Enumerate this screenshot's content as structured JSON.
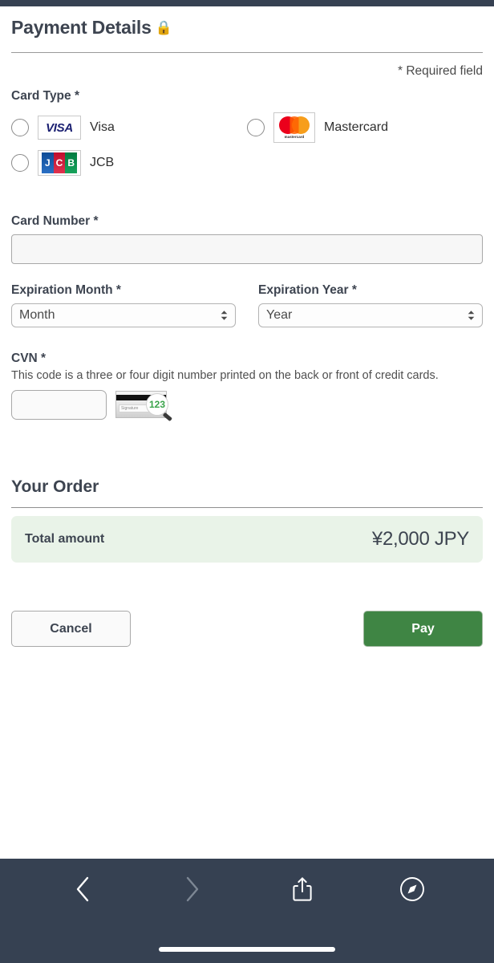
{
  "header": {
    "title": "Payment Details",
    "lock_icon": "lock-emoji",
    "required_note": "* Required field"
  },
  "form": {
    "card_type": {
      "label": "Card Type *",
      "options": [
        {
          "id": "visa",
          "label": "Visa",
          "brand": "VISA",
          "selected": false
        },
        {
          "id": "mastercard",
          "label": "Mastercard",
          "brand": "mastercard",
          "selected": false
        },
        {
          "id": "jcb",
          "label": "JCB",
          "brand": "JCB",
          "selected": false
        }
      ]
    },
    "card_number": {
      "label": "Card Number *",
      "value": "",
      "placeholder": ""
    },
    "expiration_month": {
      "label": "Expiration Month *",
      "selected": "Month"
    },
    "expiration_year": {
      "label": "Expiration Year *",
      "selected": "Year"
    },
    "cvn": {
      "label": "CVN *",
      "hint": "This code is a three or four digit number printed on the back or front of credit cards.",
      "value": "",
      "hint_image_digits": "123",
      "hint_image_signature": "Signature"
    }
  },
  "order": {
    "title": "Your Order",
    "total_label": "Total amount",
    "total_value": "¥2,000 JPY"
  },
  "actions": {
    "cancel_label": "Cancel",
    "pay_label": "Pay"
  },
  "browser_toolbar": {
    "back_icon": "chevron-left-icon",
    "forward_icon": "chevron-right-icon",
    "share_icon": "share-icon",
    "safari_icon": "compass-icon"
  },
  "colors": {
    "accent_green": "#3f8544",
    "panel_green": "#e9f3e8",
    "toolbar": "#364152",
    "text": "#3d4450",
    "visa_blue": "#1a1f71",
    "mc_red": "#eb001b",
    "mc_yellow": "#f79e1b",
    "jcb_blue": "#0e4c96",
    "jcb_red": "#be0e2d",
    "jcb_green": "#007b40"
  }
}
